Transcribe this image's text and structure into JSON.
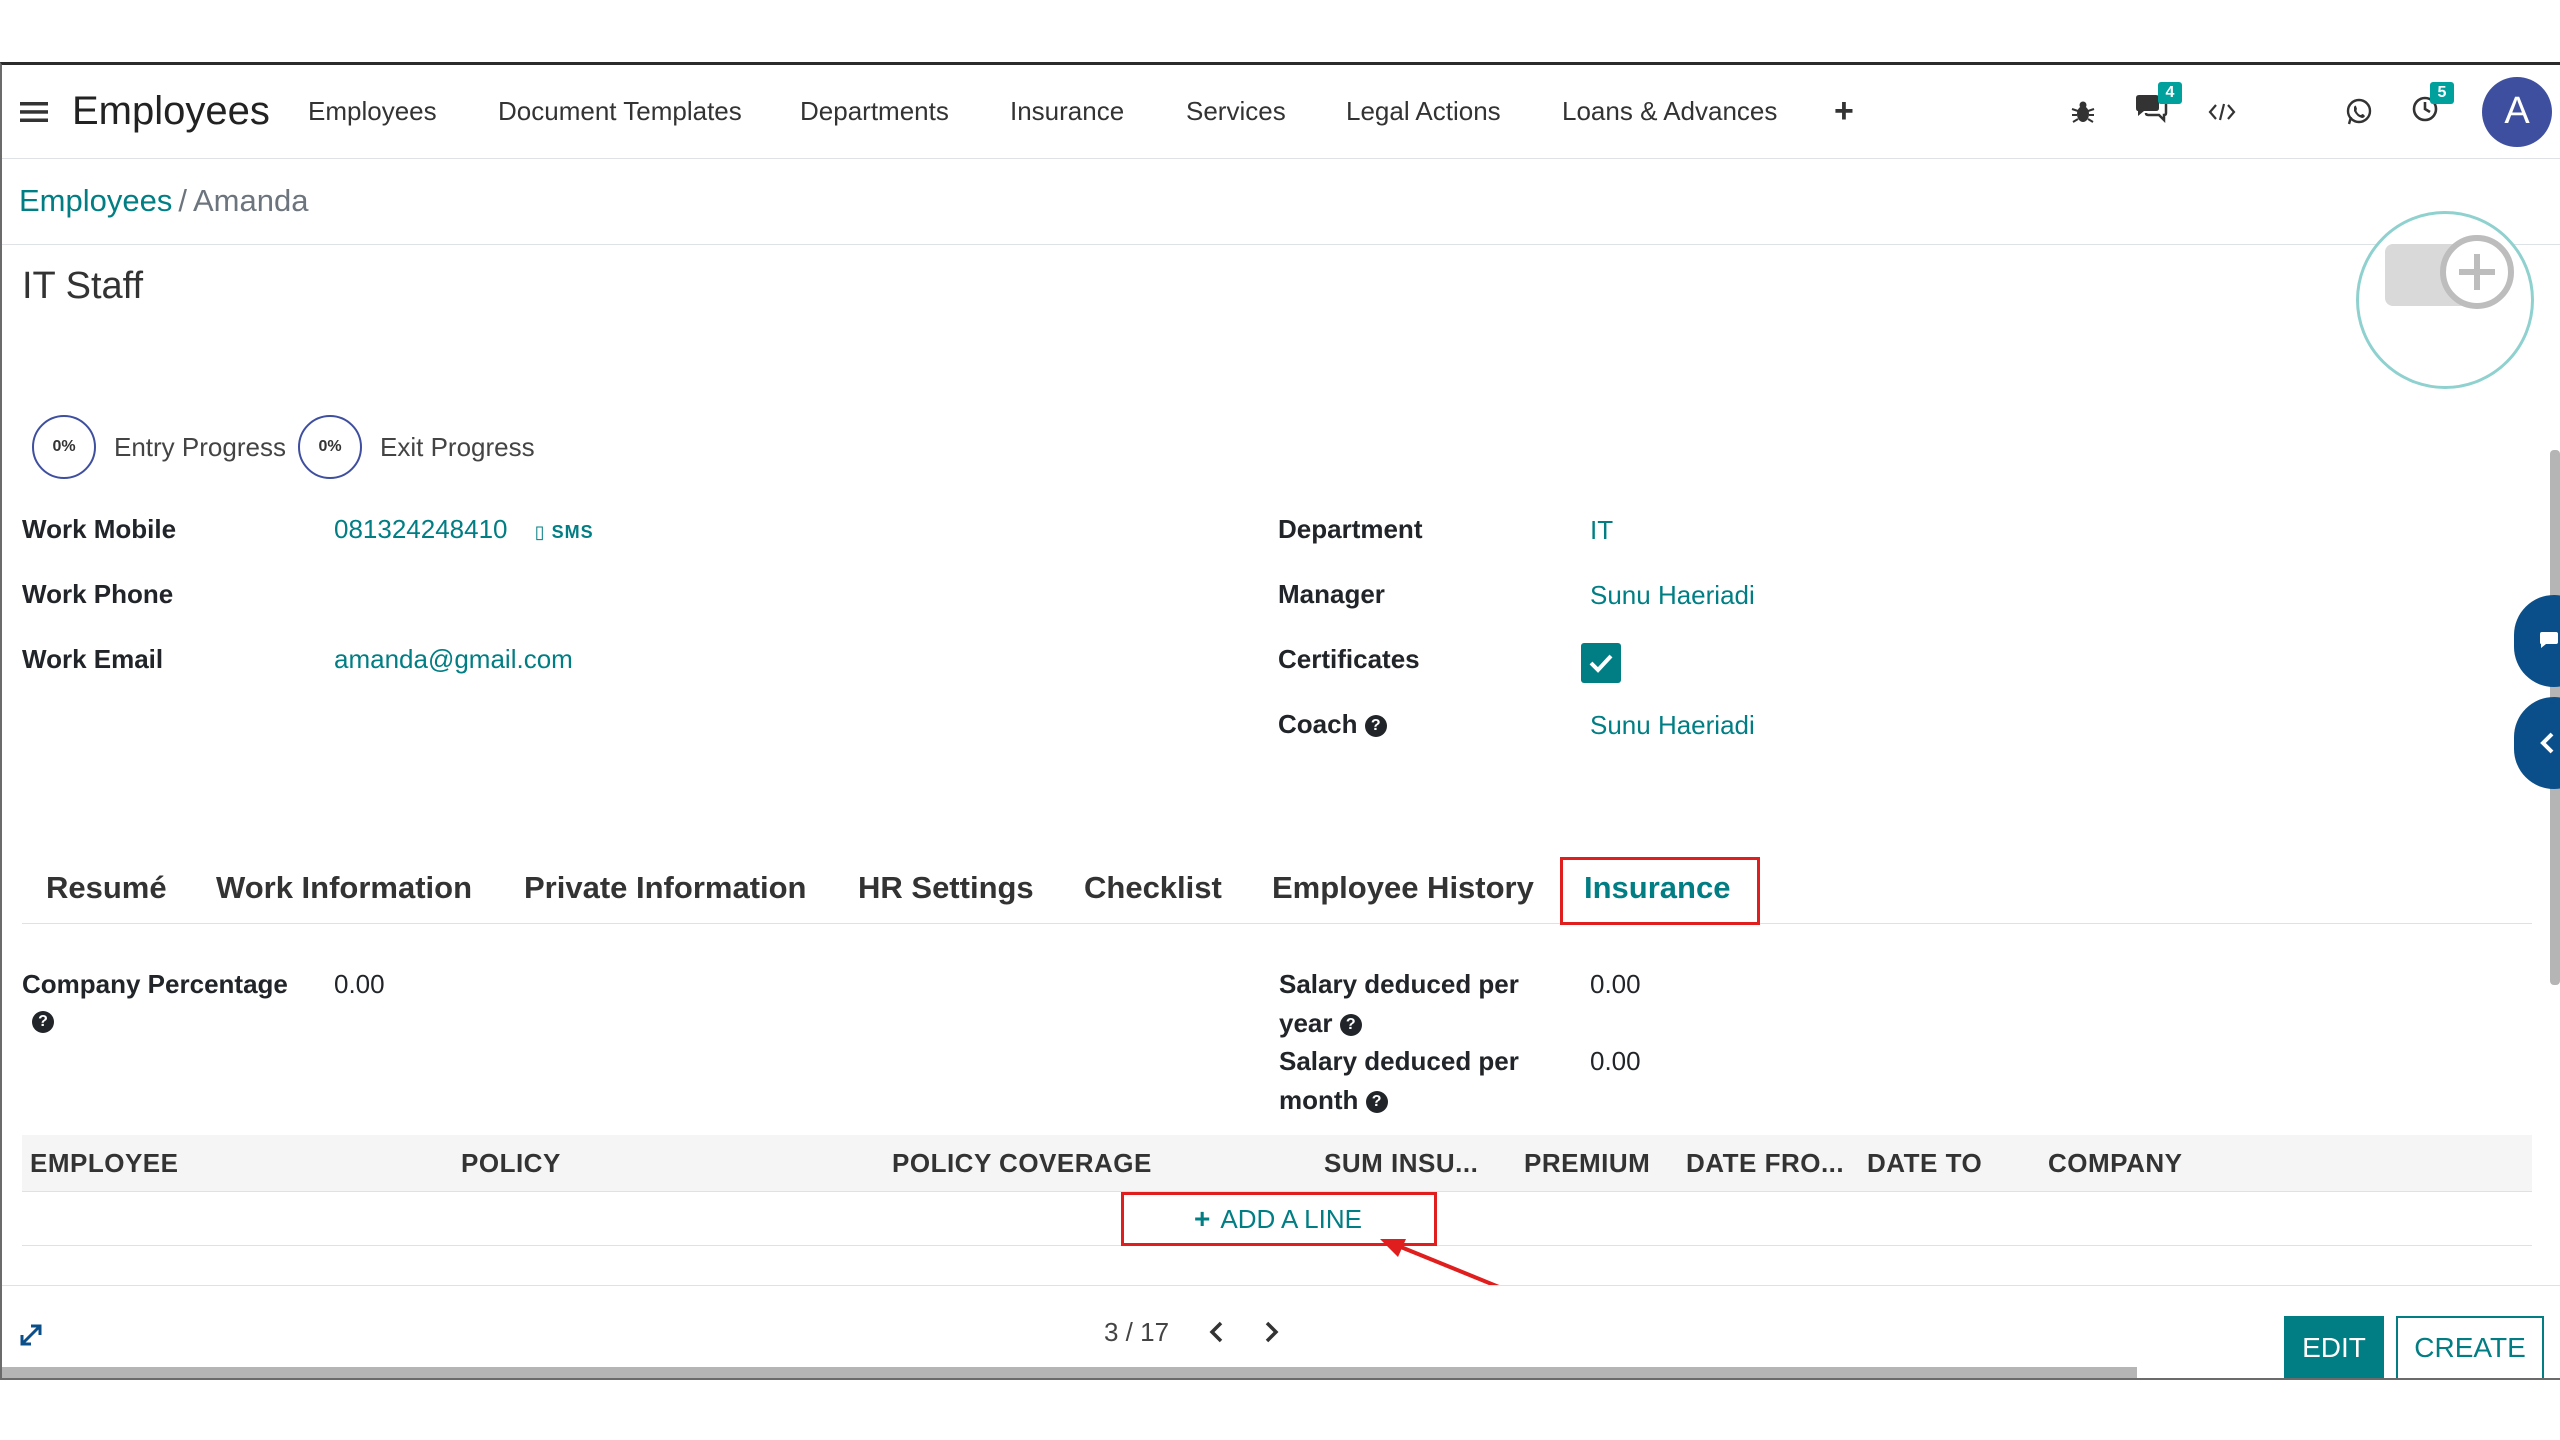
{
  "navbar": {
    "app_title": "Employees",
    "menu": [
      "Employees",
      "Document Templates",
      "Departments",
      "Insurance",
      "Services",
      "Legal Actions",
      "Loans & Advances"
    ],
    "chat_badge": "4",
    "activity_badge": "5",
    "avatar_initial": "A"
  },
  "breadcrumb": {
    "parent": "Employees",
    "separator": "/",
    "current": "Amanda"
  },
  "employee": {
    "job_title": "IT Staff",
    "entry_progress": "0%",
    "entry_label": "Entry Progress",
    "exit_progress": "0%",
    "exit_label": "Exit Progress"
  },
  "fields_left": {
    "work_mobile_label": "Work Mobile",
    "work_mobile_value": "081324248410",
    "sms_label": "SMS",
    "work_phone_label": "Work Phone",
    "work_email_label": "Work Email",
    "work_email_value": "amanda@gmail.com"
  },
  "fields_right": {
    "department_label": "Department",
    "department_value": "IT",
    "manager_label": "Manager",
    "manager_value": "Sunu Haeriadi",
    "certificates_label": "Certificates",
    "coach_label": "Coach",
    "coach_value": "Sunu Haeriadi"
  },
  "tabs": [
    "Resumé",
    "Work Information",
    "Private Information",
    "HR Settings",
    "Checklist",
    "Employee History",
    "Insurance"
  ],
  "insurance": {
    "company_percentage_label": "Company Percentage",
    "company_percentage_value": "0.00",
    "salary_year_label_1": "Salary deduced per",
    "salary_year_label_2": "year",
    "salary_year_value": "0.00",
    "salary_month_label_1": "Salary deduced per",
    "salary_month_label_2": "month",
    "salary_month_value": "0.00"
  },
  "table": {
    "headers": [
      "EMPLOYEE",
      "POLICY",
      "POLICY COVERAGE",
      "SUM INSU...",
      "PREMIUM",
      "DATE FRO...",
      "DATE TO",
      "COMPANY"
    ],
    "add_line": "ADD A LINE"
  },
  "pager": {
    "text": "3 / 17"
  },
  "buttons": {
    "edit": "EDIT",
    "create": "CREATE"
  },
  "colors": {
    "accent": "#017e84",
    "avatar": "#3f4fa0",
    "annotation": "#e01e1e"
  }
}
